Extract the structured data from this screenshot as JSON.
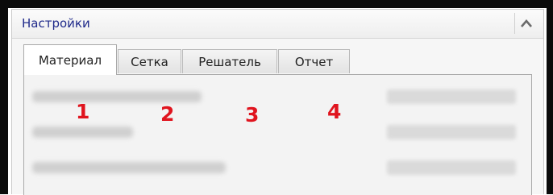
{
  "panel": {
    "title": "Настройки",
    "collapse_icon": "chevron-up-icon"
  },
  "tabs": [
    {
      "label": "Материал",
      "active": true
    },
    {
      "label": "Сетка",
      "active": false
    },
    {
      "label": "Решатель",
      "active": false
    },
    {
      "label": "Отчет",
      "active": false
    }
  ],
  "markers": [
    "1",
    "2",
    "3",
    "4"
  ],
  "colors": {
    "marker": "#e0141e",
    "title": "#1f2a8a",
    "frame": "#0b0b0b"
  }
}
